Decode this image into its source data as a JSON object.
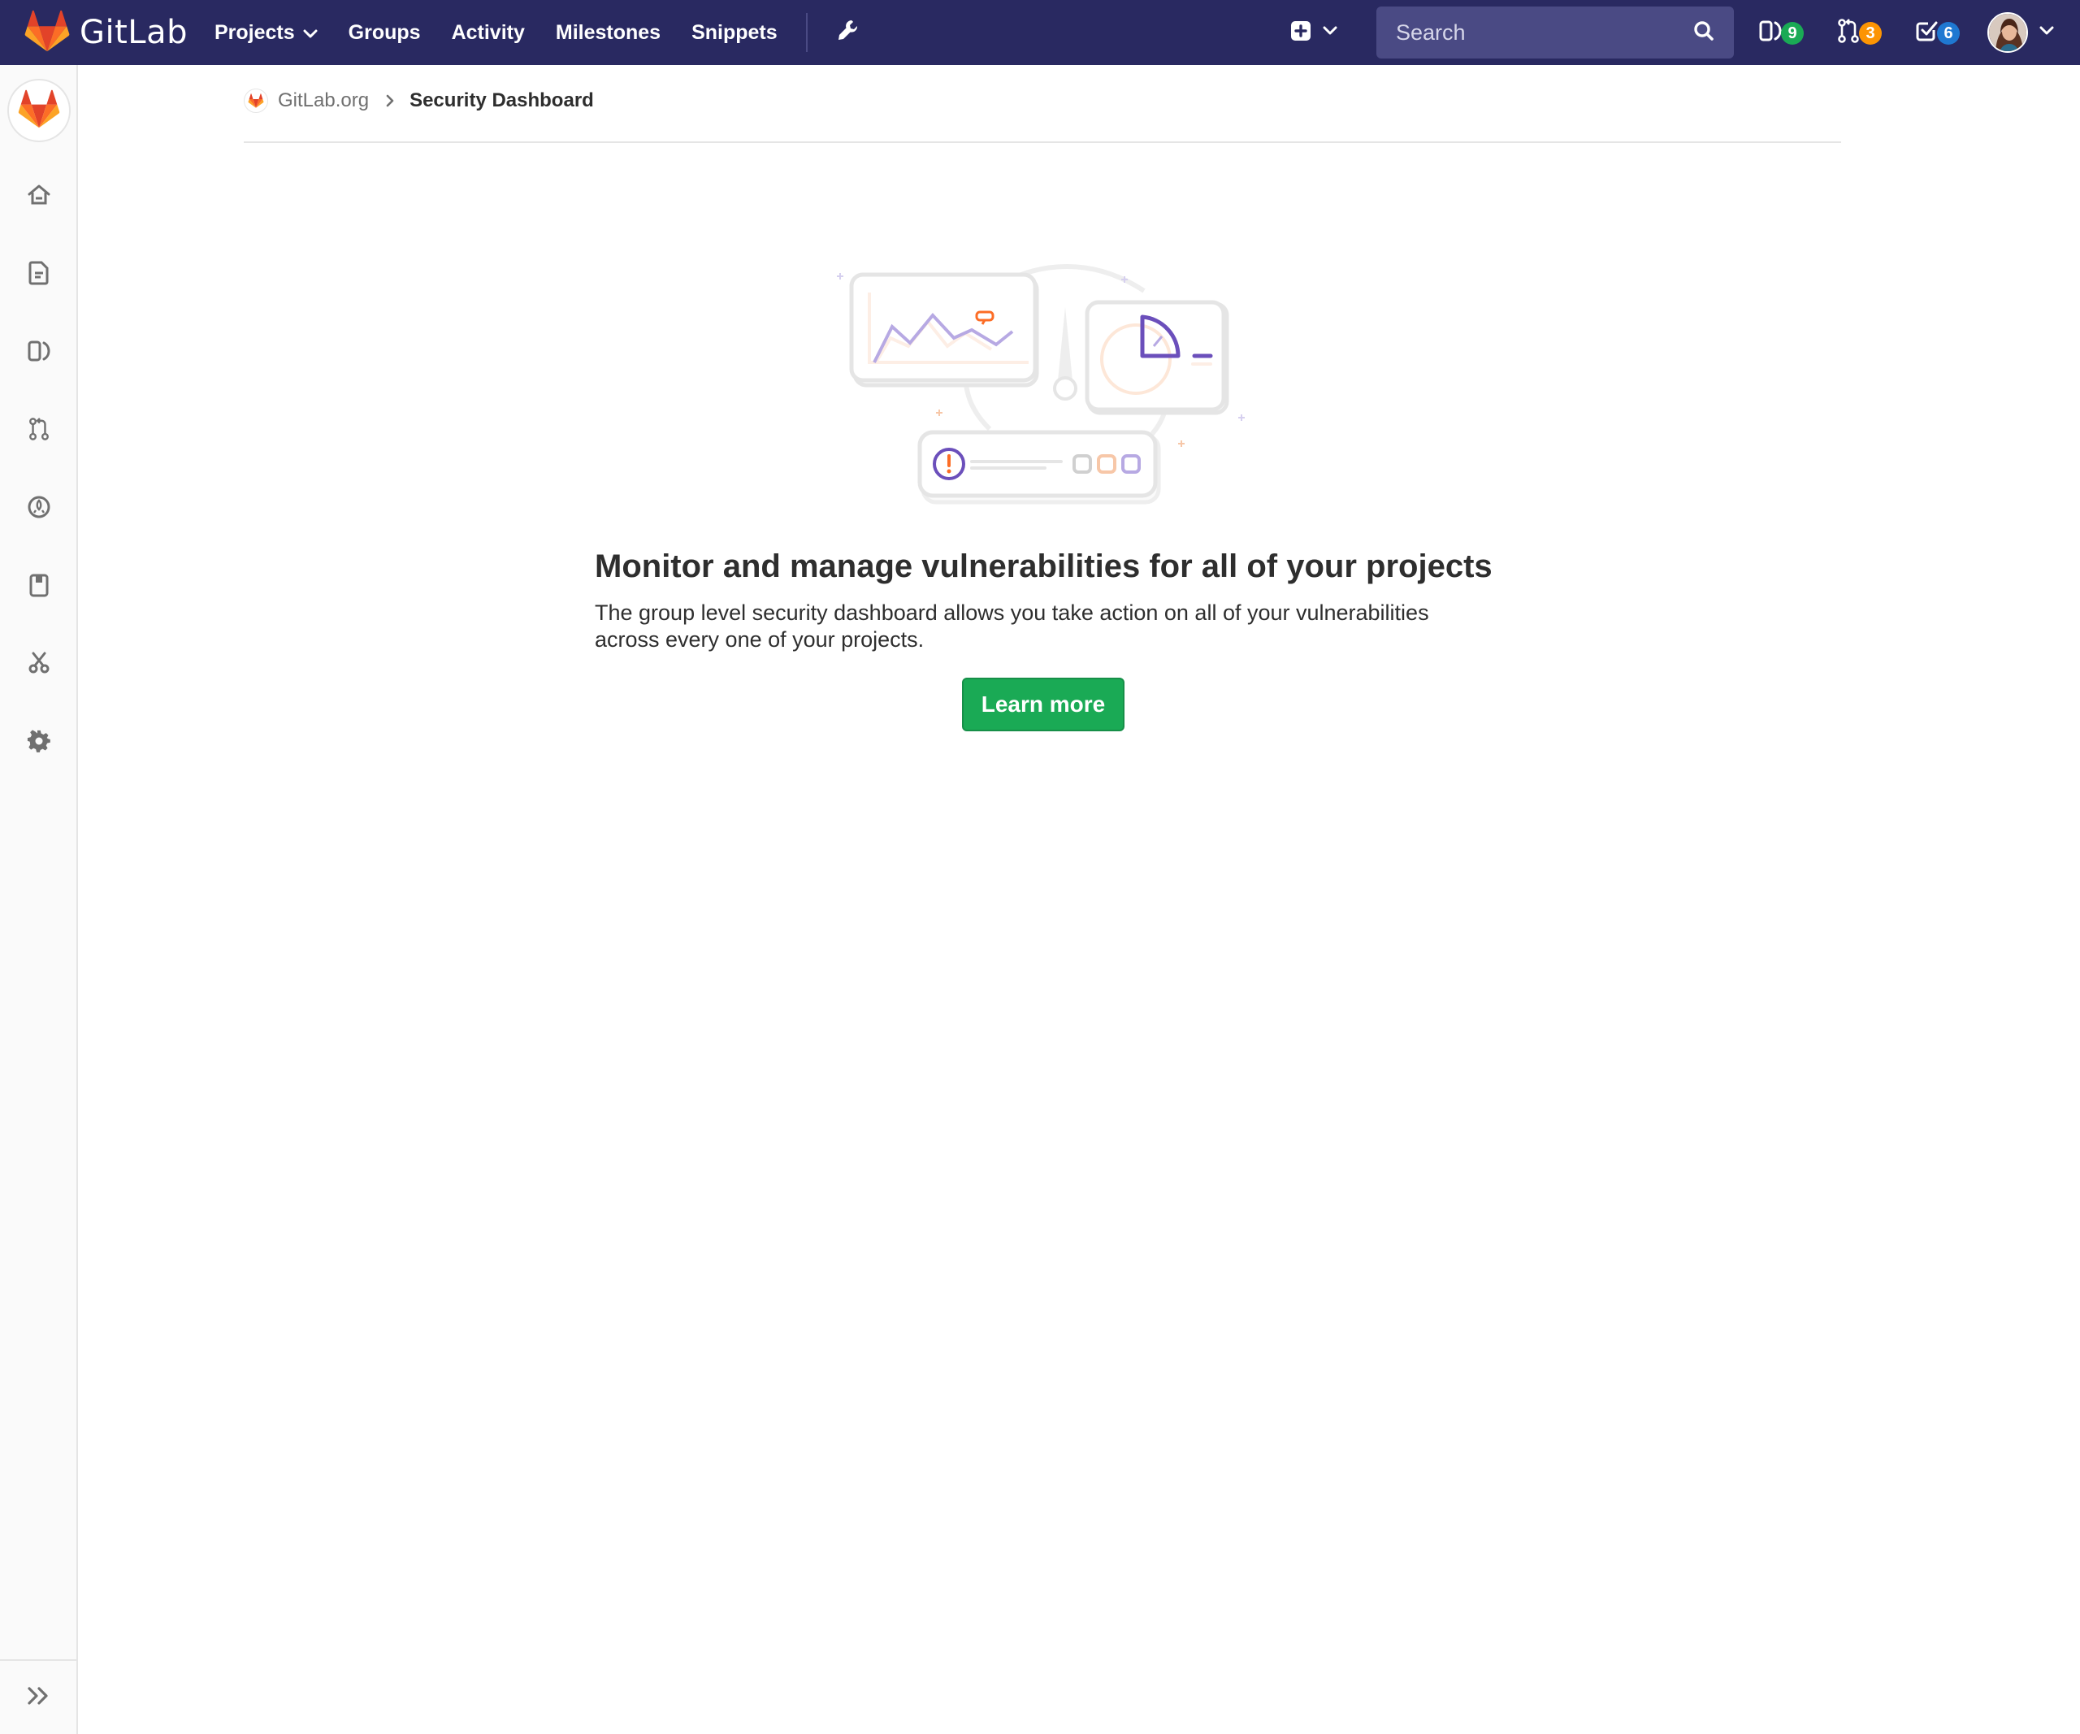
{
  "navbar": {
    "brand": "GitLab",
    "links": [
      "Projects",
      "Groups",
      "Activity",
      "Milestones",
      "Snippets"
    ],
    "search_placeholder": "Search",
    "counters": {
      "issues": "9",
      "merge_requests": "3",
      "todos": "6"
    },
    "colors": {
      "background": "#292961",
      "search_bg": "#4a4a84",
      "issues_badge": "#1aaa55",
      "merge_requests_badge": "#fc9403",
      "todos_badge": "#1f78d1"
    }
  },
  "sidebar": {
    "icons": [
      "home-icon",
      "doc-icon",
      "issues-icon",
      "merge-request-icon",
      "rocket-icon",
      "clipboard-icon",
      "scissors-icon",
      "gear-icon"
    ],
    "collapse_icon": "double-chevron-right-icon"
  },
  "breadcrumbs": {
    "group": "GitLab.org",
    "current": "Security Dashboard"
  },
  "empty_state": {
    "title": "Monitor and manage vulnerabilities for all of your projects",
    "description": "The group level security dashboard allows you take action on all of your vulnerabilities across every one of your projects.",
    "button": "Learn more",
    "button_color": "#1aaa55"
  }
}
